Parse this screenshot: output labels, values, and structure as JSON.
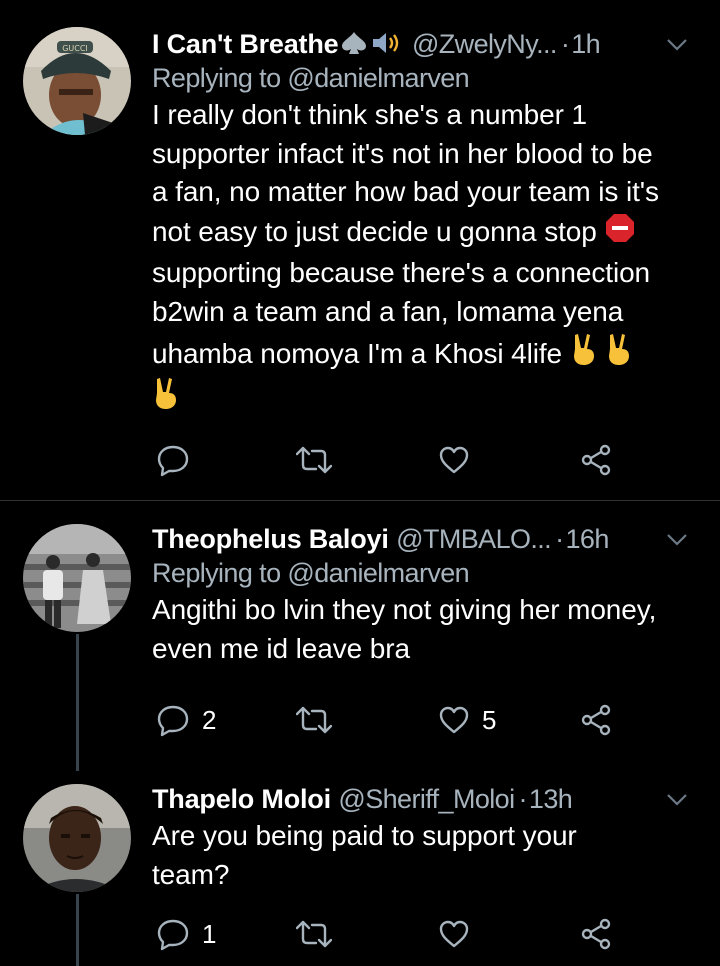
{
  "tweets": [
    {
      "name": "I Can't Breathe",
      "name_icons": [
        "spade-icon",
        "speaker-icon"
      ],
      "handle": "@ZwelyNy...",
      "time": "1h",
      "replying_prefix": "Replying to",
      "replying_to": "@danielmarven",
      "text_lines": [
        "I really don't think she's a number 1",
        "supporter infact it's not in her blood to be",
        "a fan, no matter how bad your team is it's",
        "not easy to just decide u gonna stop",
        "supporting because there's a connection",
        "b2win a team and a fan, lomama yena",
        "uhamba nomoya I'm a Khosi 4life"
      ],
      "reply_count": "",
      "retweet_count": "",
      "like_count": ""
    },
    {
      "name": "Theophelus Baloyi",
      "handle": "@TMBALO...",
      "time": "16h",
      "replying_prefix": "Replying to",
      "replying_to": "@danielmarven",
      "text_lines": [
        "Angithi bo lvin they not giving her money,",
        "even me id leave bra"
      ],
      "reply_count": "2",
      "retweet_count": "",
      "like_count": "5"
    },
    {
      "name": "Thapelo Moloi",
      "handle": "@Sheriff_Moloi",
      "time": "13h",
      "text_lines": [
        "Are you being paid to support your",
        "team?"
      ],
      "reply_count": "1",
      "retweet_count": "",
      "like_count": ""
    }
  ],
  "colors": {
    "background": "#000000",
    "text_primary": "#ffffff",
    "text_secondary": "#a7b3bd",
    "icon": "#a7b3bd",
    "divider": "#2f3336",
    "stop_sign": "#d8242a",
    "victory_hand": "#f7c23a"
  }
}
